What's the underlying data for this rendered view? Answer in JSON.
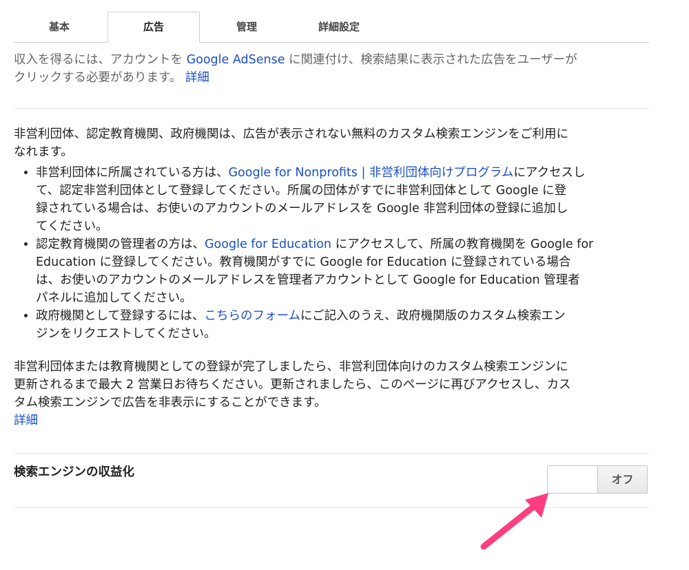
{
  "tabs": [
    {
      "label": "基本"
    },
    {
      "label": "広告"
    },
    {
      "label": "管理"
    },
    {
      "label": "詳細設定"
    }
  ],
  "intro": {
    "text_before": "収入を得るには、アカウントを ",
    "adsense_link": "Google AdSense",
    "text_line1_after": " に関連付け、検索結果に表示された広告をユーザーが",
    "text_line2": "クリックする必要があります。 ",
    "details_link": "詳細"
  },
  "nonprofit": {
    "lead_line1": "非営利団体、認定教育機関、政府機関は、広告が表示されない無料のカスタム検索エンジンをご利用に",
    "lead_line2": "なれます。",
    "bullets": [
      {
        "before": "非営利団体に所属されている方は、",
        "link": "Google for Nonprofits | 非営利団体向けプログラム",
        "after_line1": "にアクセスし",
        "line2": "て、認定非営利団体として登録してください。所属の団体がすでに非営利団体として Google に登",
        "line3": "録されている場合は、お使いのアカウントのメールアドレスを Google 非営利団体の登録に追加し",
        "line4": "てください。"
      },
      {
        "before": "認定教育機関の管理者の方は、",
        "link": "Google for Education",
        "after_line1": " にアクセスして、所属の教育機関を Google for",
        "line2": "Education に登録してください。教育機関がすでに Google for Education に登録されている場合",
        "line3": "は、お使いのアカウントのメールアドレスを管理者アカウントとして Google for Education 管理者",
        "line4": "パネルに追加してください。"
      },
      {
        "before": "政府機関として登録するには、",
        "link": "こちらのフォーム",
        "after_line1": "にご記入のうえ、政府機関版のカスタム検索エン",
        "line2": "ジンをリクエストしてください。"
      }
    ],
    "after_line1": "非営利団体または教育機関としての登録が完了しましたら、非営利団体向けのカスタム検索エンジンに",
    "after_line2": "更新されるまで最大 2 営業日お待ちください。更新されましたら、このページに再びアクセスし、カス",
    "after_line3": "タム検索エンジンで広告を非表示にすることができます。",
    "details_link": "詳細"
  },
  "monetize": {
    "label": "検索エンジンの収益化",
    "toggle_state": "オフ"
  },
  "colors": {
    "link": "#1a4fc9",
    "arrow": "#ff3d7f",
    "divider": "#e4e4e4"
  }
}
